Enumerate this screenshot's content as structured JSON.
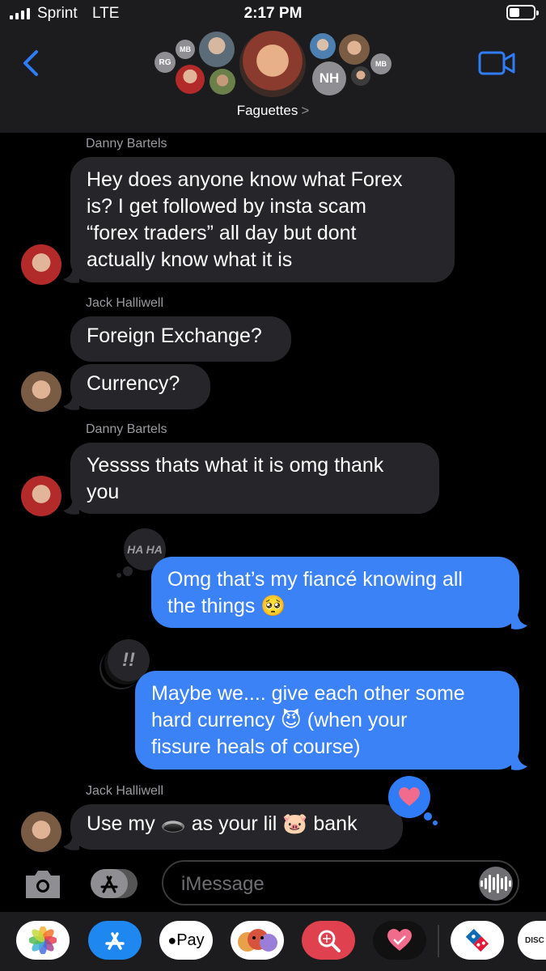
{
  "status": {
    "carrier": "Sprint",
    "network": "LTE",
    "time": "2:17 PM"
  },
  "header": {
    "group_name": "Faguettes",
    "chevron": ">",
    "avatars": {
      "rg": "RG",
      "mb_left": "MB",
      "nh": "NH",
      "mb_right": "MB"
    }
  },
  "messages": [
    {
      "sender": "Danny Bartels",
      "lines": [
        "Hey does anyone know what Forex",
        "is? I get followed by insta scam",
        "“forex traders” all day but dont",
        "actually know what it is"
      ]
    },
    {
      "sender": "Jack Halliwell",
      "text": "Foreign Exchange?"
    },
    {
      "text": "Currency?"
    },
    {
      "sender": "Danny Bartels",
      "lines": [
        "Yessss thats what it is omg thank",
        "you"
      ]
    },
    {
      "tapback": "HA HA",
      "lines": [
        "Omg that’s my fiancé knowing all",
        "the things 🥺"
      ]
    },
    {
      "tapback": "!!",
      "lines": [
        "Maybe we.... give each other some",
        "hard currency 😈 (when your",
        "fissure heals of course)"
      ]
    },
    {
      "sender": "Jack Halliwell",
      "text": "Use my 🕳️ as your lil 🐷 bank",
      "tapback": "heart"
    }
  ],
  "input": {
    "placeholder": "iMessage"
  },
  "apps": [
    "photos-app",
    "app-store-app",
    "apple-pay-app",
    "memoji-app",
    "search-images-app",
    "heart-app",
    "dominos-app",
    "discover-app"
  ],
  "app_labels": {
    "apple_pay": "Pay",
    "discover": "DISC"
  },
  "colors": {
    "outgoing": "#3b82f6",
    "incoming": "#26252a",
    "accent": "#2f7cf6",
    "heart": "#f06b8c"
  }
}
